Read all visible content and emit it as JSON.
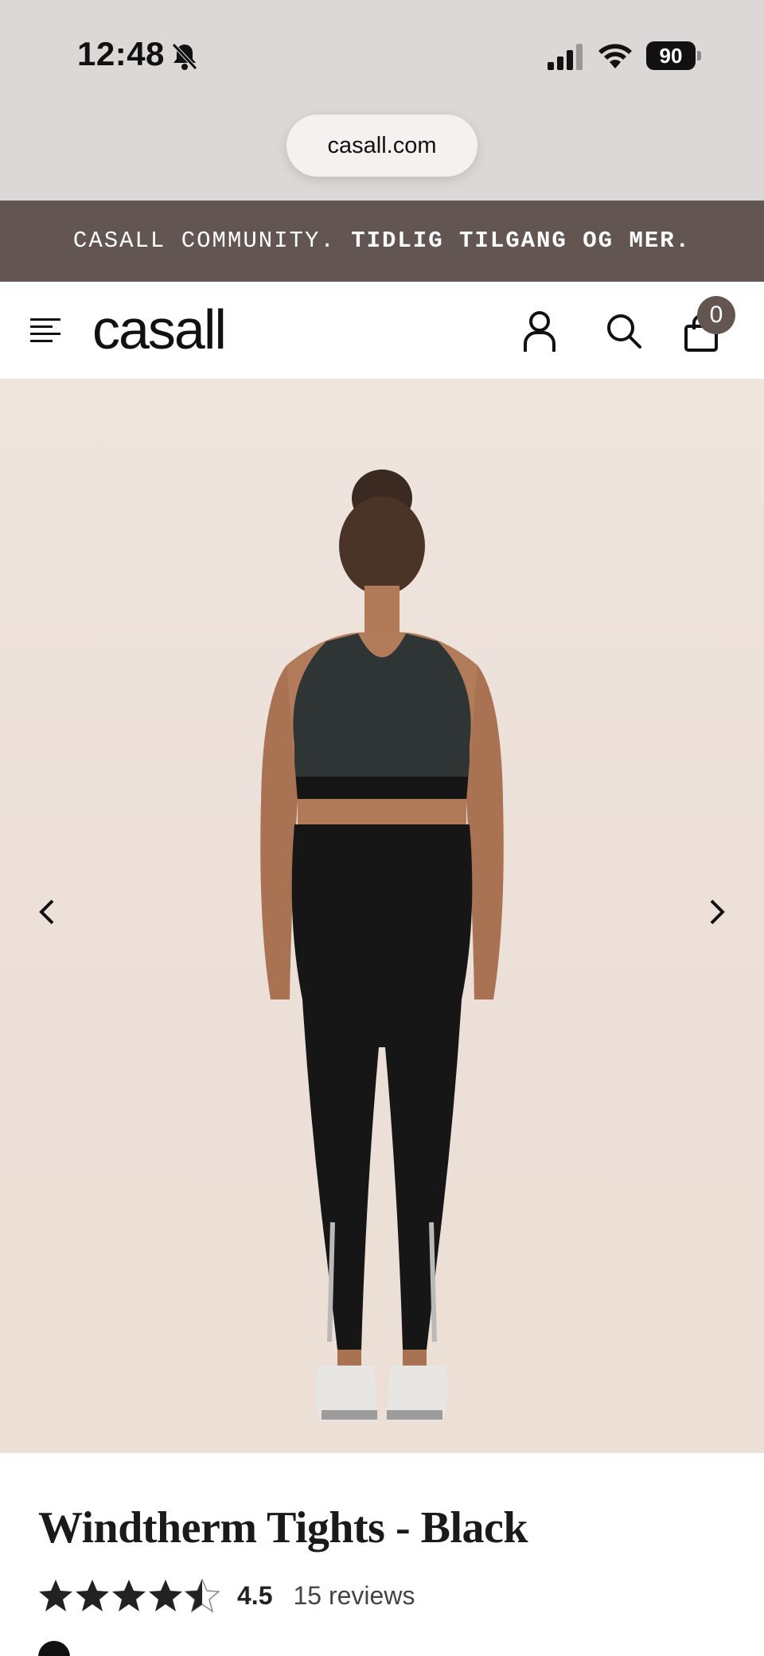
{
  "status_bar": {
    "time": "12:48",
    "battery": "90",
    "icons": [
      "bell-slash-icon",
      "signal-icon",
      "wifi-icon",
      "battery-icon"
    ]
  },
  "browser": {
    "url": "casall.com"
  },
  "promo": {
    "text_regular": "CASALL COMMUNITY.",
    "text_bold": "TIDLIG TILGANG OG MER."
  },
  "header": {
    "logo": "casall",
    "cart_count": "0",
    "icons": [
      "menu-icon",
      "account-icon",
      "search-icon",
      "bag-icon"
    ]
  },
  "gallery": {
    "prev_icon": "chevron-left-icon",
    "next_icon": "chevron-right-icon"
  },
  "product": {
    "title": "Windtherm Tights - Black",
    "rating": "4.5",
    "rating_fraction": 0.9,
    "reviews": "15 reviews",
    "swatch_color": "#111111"
  },
  "colors": {
    "chrome_bg": "#dcd8d8",
    "promo_bg": "#635552",
    "image_bg": "#ecdfd7"
  }
}
